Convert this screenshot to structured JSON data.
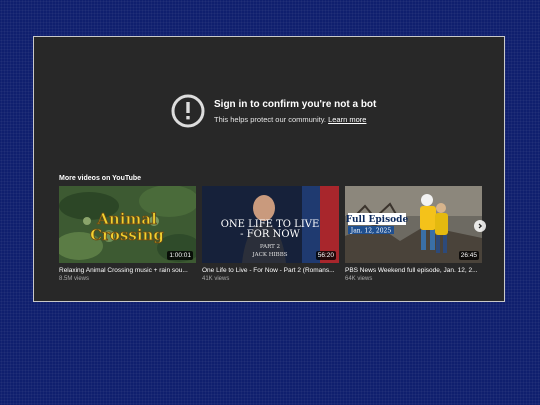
{
  "error": {
    "title": "Sign in to confirm you're not a bot",
    "subtitle": "This helps protect our community.",
    "learn_more": "Learn more"
  },
  "more_videos_label": "More videos on YouTube",
  "videos": [
    {
      "title": "Relaxing Animal Crossing music + rain sou...",
      "views": "8.5M views",
      "duration": "1:00:01",
      "thumb_text": [
        "Animal",
        "Crossing"
      ]
    },
    {
      "title": "One Life to Live - For Now - Part 2 (Romans...",
      "views": "41K views",
      "duration": "56:20",
      "thumb_text": [
        "ONE LIFE TO LIVE",
        "- FOR NOW",
        "PART 2",
        "JACK HIBBS"
      ]
    },
    {
      "title": "PBS News Weekend full episode, Jan. 12, 2...",
      "views": "64K views",
      "duration": "26:45",
      "thumb_text": [
        "Full Episode",
        "Jan. 12, 2025"
      ]
    }
  ],
  "colors": {
    "player_bg": "#282828",
    "page_bg": "#0f1f6e"
  }
}
